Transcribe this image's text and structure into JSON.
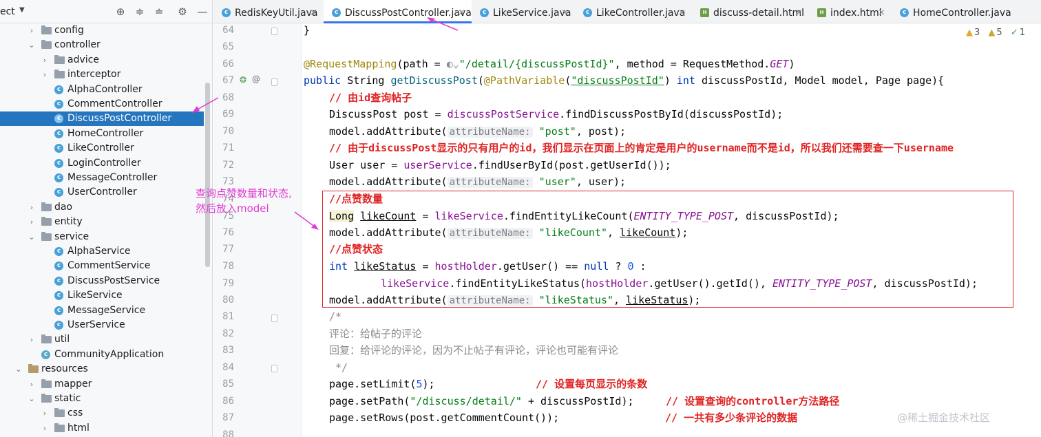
{
  "project_panel": {
    "title": "ect",
    "tree": [
      {
        "label": "config",
        "type": "folder",
        "indent": 1,
        "expanded": false
      },
      {
        "label": "controller",
        "type": "folder",
        "indent": 1,
        "expanded": true
      },
      {
        "label": "advice",
        "type": "folder",
        "indent": 2,
        "expanded": false
      },
      {
        "label": "interceptor",
        "type": "folder",
        "indent": 2,
        "expanded": false
      },
      {
        "label": "AlphaController",
        "type": "class",
        "indent": 2
      },
      {
        "label": "CommentController",
        "type": "class",
        "indent": 2
      },
      {
        "label": "DiscussPostController",
        "type": "class",
        "indent": 2,
        "selected": true
      },
      {
        "label": "HomeController",
        "type": "class",
        "indent": 2
      },
      {
        "label": "LikeController",
        "type": "class",
        "indent": 2
      },
      {
        "label": "LoginController",
        "type": "class",
        "indent": 2
      },
      {
        "label": "MessageController",
        "type": "class",
        "indent": 2
      },
      {
        "label": "UserController",
        "type": "class",
        "indent": 2
      },
      {
        "label": "dao",
        "type": "folder",
        "indent": 1,
        "expanded": false
      },
      {
        "label": "entity",
        "type": "folder",
        "indent": 1,
        "expanded": false
      },
      {
        "label": "service",
        "type": "folder",
        "indent": 1,
        "expanded": true
      },
      {
        "label": "AlphaService",
        "type": "class",
        "indent": 2
      },
      {
        "label": "CommentService",
        "type": "class",
        "indent": 2
      },
      {
        "label": "DiscussPostService",
        "type": "class",
        "indent": 2
      },
      {
        "label": "LikeService",
        "type": "class",
        "indent": 2
      },
      {
        "label": "MessageService",
        "type": "class",
        "indent": 2
      },
      {
        "label": "UserService",
        "type": "class",
        "indent": 2
      },
      {
        "label": "util",
        "type": "folder",
        "indent": 1,
        "expanded": false
      },
      {
        "label": "CommunityApplication",
        "type": "app",
        "indent": 1
      },
      {
        "label": "resources",
        "type": "resfolder",
        "indent": 0,
        "expanded": true
      },
      {
        "label": "mapper",
        "type": "folder",
        "indent": 1,
        "expanded": false
      },
      {
        "label": "static",
        "type": "folder",
        "indent": 1,
        "expanded": true
      },
      {
        "label": "css",
        "type": "folder",
        "indent": 2,
        "expanded": false
      },
      {
        "label": "html",
        "type": "folder",
        "indent": 2,
        "expanded": false
      }
    ]
  },
  "tabs": [
    {
      "label": "RedisKeyUtil.java",
      "icon": "class-icon"
    },
    {
      "label": "DiscussPostController.java",
      "icon": "class-icon",
      "active": true
    },
    {
      "label": "LikeService.java",
      "icon": "class-icon"
    },
    {
      "label": "LikeController.java",
      "icon": "class-icon"
    },
    {
      "label": "discuss-detail.html",
      "icon": "html-icon"
    },
    {
      "label": "index.html",
      "icon": "html-icon"
    },
    {
      "label": "HomeController.java",
      "icon": "class-icon"
    }
  ],
  "inspections": {
    "warnings": "3",
    "weak_warnings": "5",
    "ok": "1"
  },
  "line_numbers": [
    "64",
    "65",
    "66",
    "67",
    "68",
    "69",
    "70",
    "71",
    "72",
    "73",
    "74",
    "75",
    "76",
    "77",
    "78",
    "79",
    "80",
    "81",
    "82",
    "83",
    "84",
    "85",
    "86",
    "87",
    "88"
  ],
  "code": {
    "l64": "}",
    "l66_ann": "@RequestMapping",
    "l66_a": "(path = ",
    "l66_str": "\"/detail/{discussPostId}\"",
    "l66_b": ", method = RequestMethod.",
    "l66_get": "GET",
    "l66_c": ")",
    "l67_kw": "public",
    "l67_a": " String ",
    "l67_fn": "getDiscussPost",
    "l67_b": "(",
    "l67_ann": "@PathVariable",
    "l67_c": "(",
    "l67_str": "\"discussPostId\"",
    "l67_d": ") ",
    "l67_int": "int",
    "l67_e": " discussPostId, Model model, Page page){",
    "l68_cmt": "// 由id查询帖子",
    "l69_a": "DiscussPost post = ",
    "l69_fld": "discussPostService",
    "l69_b": ".findDiscussPostById(discussPostId);",
    "l70_a": "model.addAttribute(",
    "l70_hint": "attributeName:",
    "l70_str": "\"post\"",
    "l70_b": ", post);",
    "l71_cmt": "// 由于discussPost显示的只有用户的id，我们显示在页面上的肯定是用户的username而不是id，所以我们还需要查一下username",
    "l72_a": "User user = ",
    "l72_fld": "userService",
    "l72_b": ".findUserById(post.getUserId());",
    "l73_a": "model.addAttribute(",
    "l73_hint": "attributeName:",
    "l73_str": "\"user\"",
    "l73_b": ", user);",
    "l74_cmt": "//点赞数量",
    "l75_long": "Long",
    "l75_var": "likeCount",
    "l75_a": " = ",
    "l75_fld": "likeService",
    "l75_b": ".findEntityLikeCount(",
    "l75_const": "ENTITY_TYPE_POST",
    "l75_c": ", discussPostId);",
    "l76_a": "model.addAttribute(",
    "l76_hint": "attributeName:",
    "l76_str": "\"likeCount\"",
    "l76_b": ", ",
    "l76_var": "likeCount",
    "l76_c": ");",
    "l77_cmt": "//点赞状态",
    "l78_int": "int",
    "l78_var": "likeStatus",
    "l78_a": " = ",
    "l78_fld": "hostHolder",
    "l78_b": ".getUser() == ",
    "l78_null": "null",
    "l78_c": " ? ",
    "l78_num": "0",
    "l78_d": " :",
    "l79_fld": "likeService",
    "l79_a": ".findEntityLikeStatus(",
    "l79_fld2": "hostHolder",
    "l79_b": ".getUser().getId(), ",
    "l79_const": "ENTITY_TYPE_POST",
    "l79_c": ", discussPostId);",
    "l80_a": "model.addAttribute(",
    "l80_hint": "attributeName:",
    "l80_str": "\"likeStatus\"",
    "l80_b": ", ",
    "l80_var": "likeStatus",
    "l80_c": ");",
    "l81_doc": "/*",
    "l82_doc": "评论：给帖子的评论",
    "l83_doc": "回复：给评论的评论，因为不止帖子有评论，评论也可能有评论",
    "l84_doc": " */",
    "l85_a": "page.setLimit(",
    "l85_num": "5",
    "l85_b": ");",
    "l85_cmt": "// 设置每页显示的条数",
    "l86_a": "page.setPath(",
    "l86_str": "\"/discuss/detail/\"",
    "l86_b": " + discussPostId);",
    "l86_cmt": "// 设置查询的controller方法路径",
    "l87_a": "page.setRows(post.getCommentCount());",
    "l87_cmt": "// 一共有多少条评论的数据"
  },
  "annotation": {
    "line1": "查询点赞数量和状态,",
    "line2": "然后放入model"
  },
  "watermark": "@稀土掘金技术社区",
  "colors": {
    "selection": "#2675bf",
    "accent": "#3574f0",
    "red_box": "#e02424",
    "annotation": "#e23bd1"
  }
}
